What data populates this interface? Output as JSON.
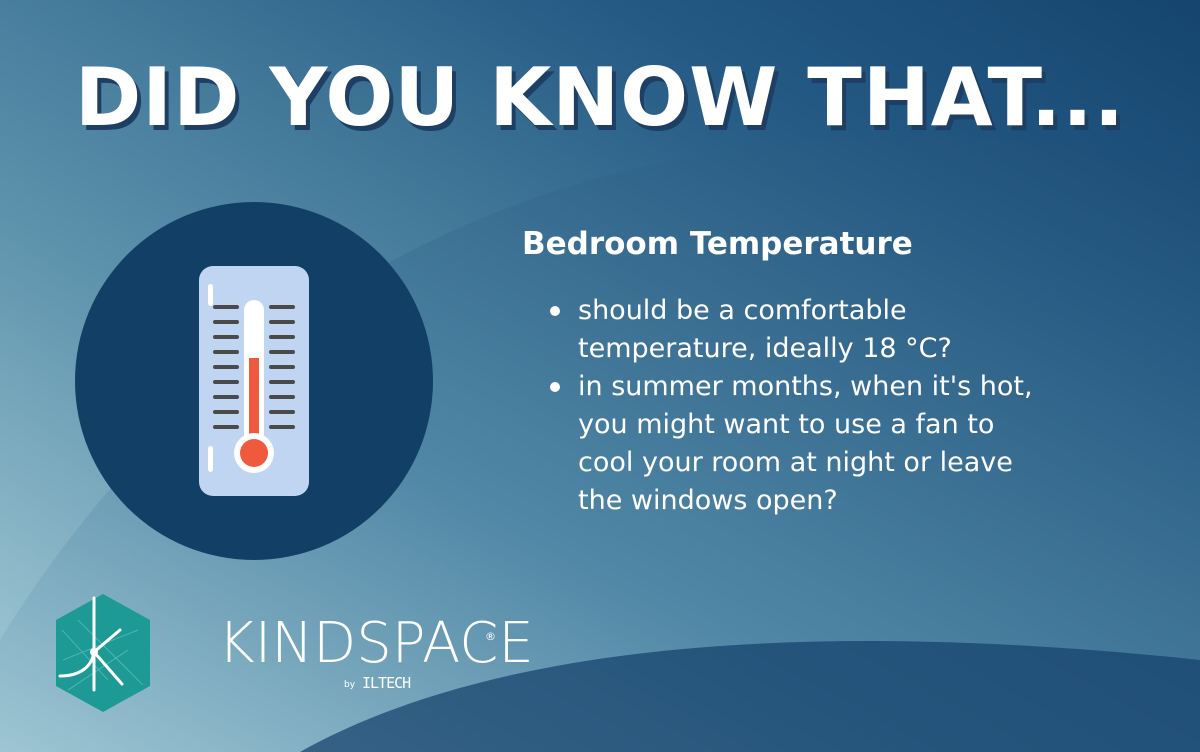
{
  "headline": "DID YOU KNOW THAT...",
  "info": {
    "title": "Bedroom Temperature",
    "bullets": [
      {
        "lines": [
          "should be a comfortable",
          "temperature, ideally 18 °C?"
        ]
      },
      {
        "lines": [
          "in summer months, when it's hot,",
          "you might want to use a fan to",
          "cool your room at night or leave",
          "the windows open?"
        ]
      }
    ]
  },
  "logo": {
    "wordmark": "KINDSPACE",
    "registered": "®",
    "by": "by",
    "sub": "ILTECH"
  },
  "icons": {
    "thermometer": "thermometer-icon",
    "logo_mark": "kindspace-hexagon-logo"
  },
  "colors": {
    "headline_shadow": "#1e3f63",
    "circle": "#123f66",
    "thermo_card": "#bfd5f2",
    "mercury": "#ee5a3b",
    "logo_teal": "#1d9a96"
  }
}
